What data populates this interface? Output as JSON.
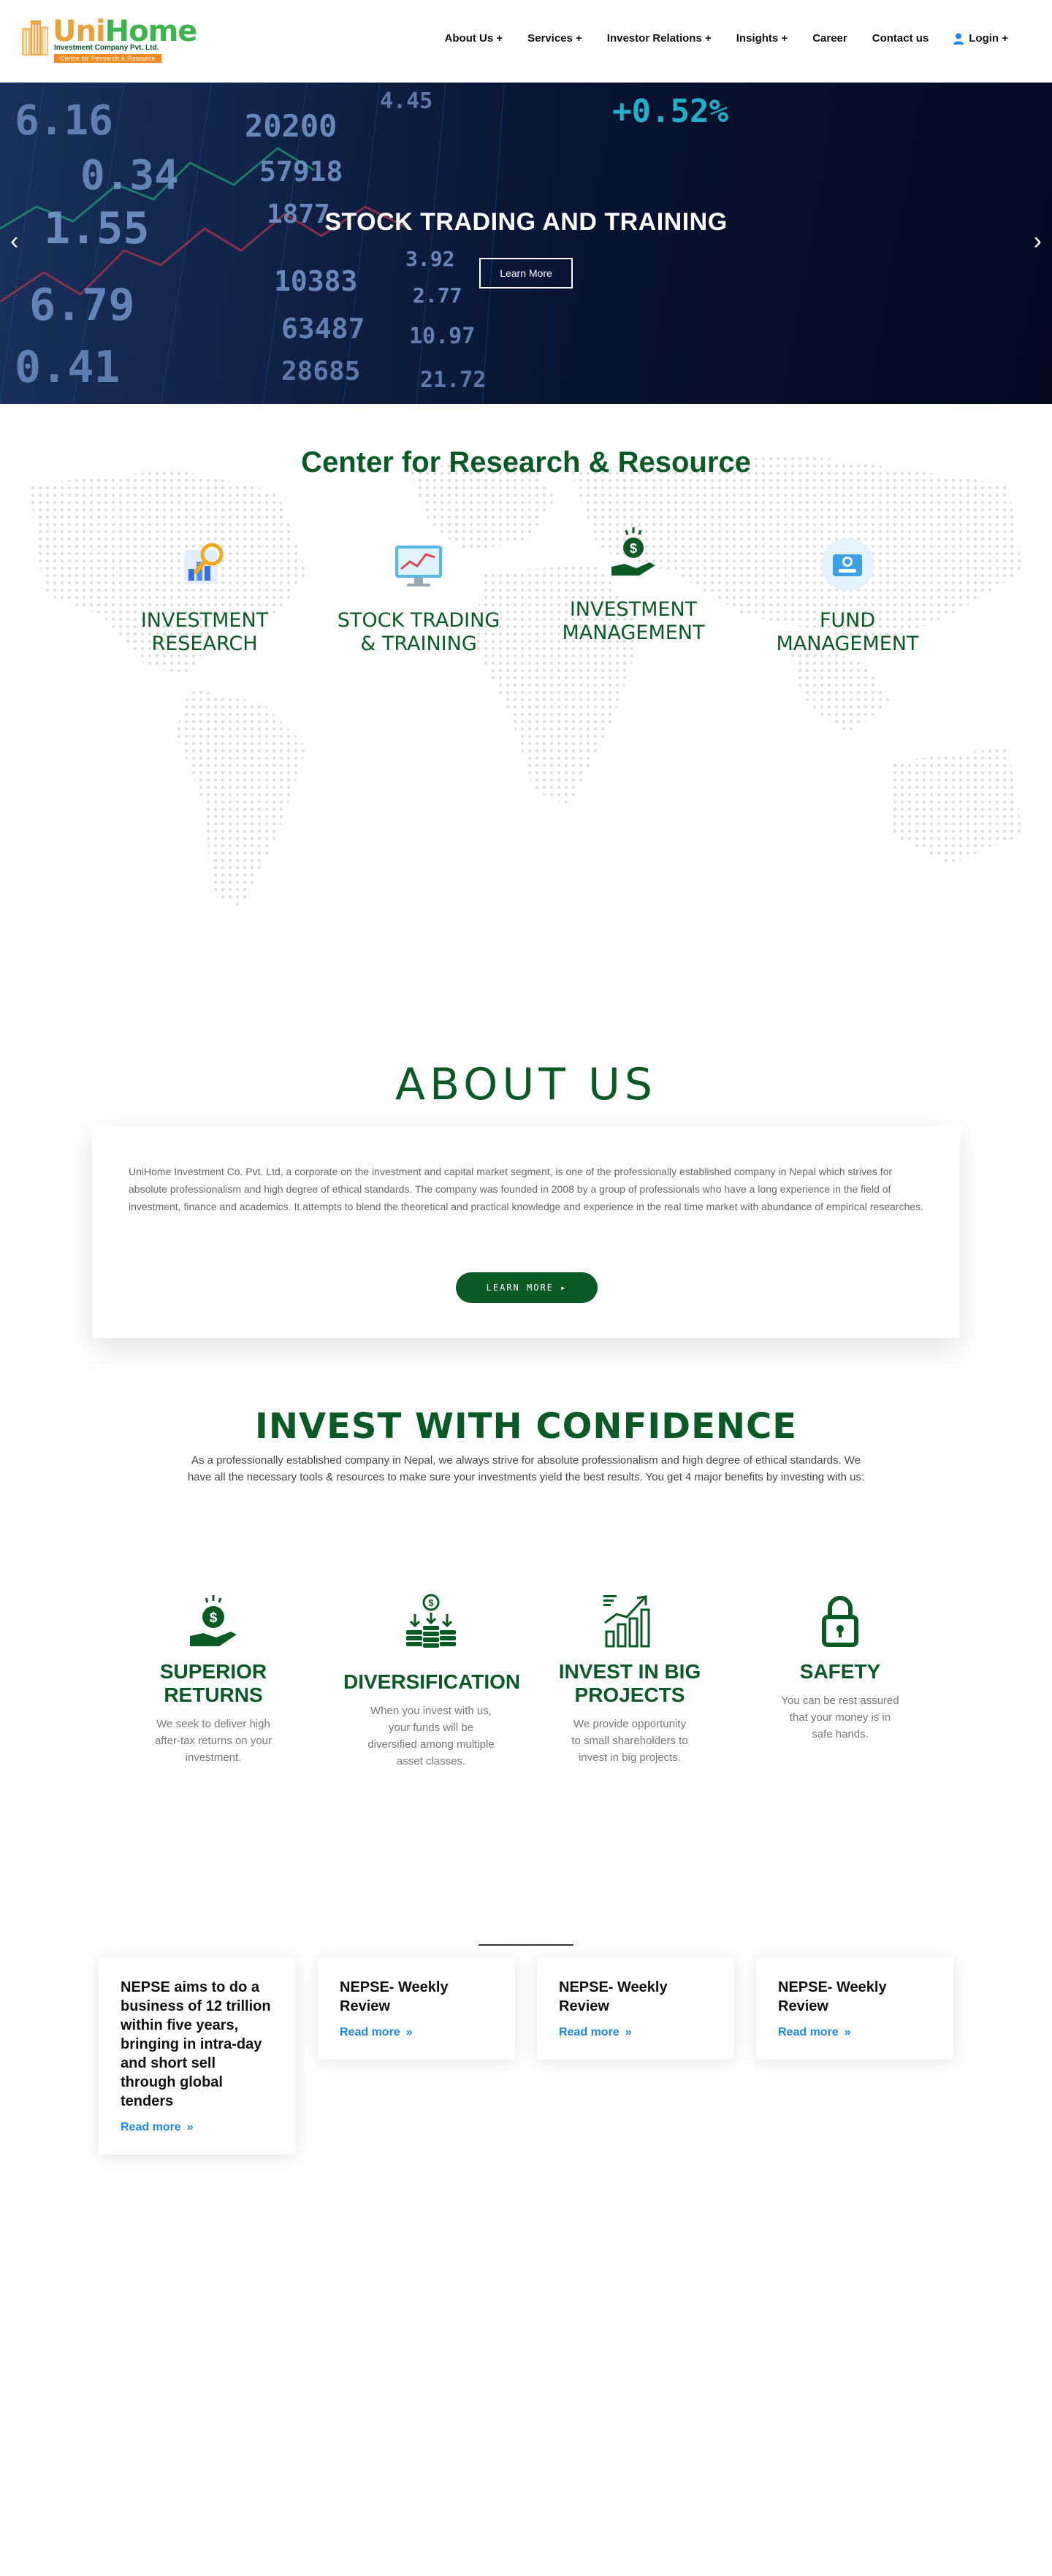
{
  "logo": {
    "uni": "Uni",
    "home": "Home",
    "subtitle": "Investment Company Pvt. Ltd.",
    "tagline": "Centre for Research & Resource"
  },
  "nav": {
    "items": [
      "About Us +",
      "Services +",
      "Investor Relations +",
      "Insights +",
      "Career",
      "Contact us"
    ],
    "login": "Login +"
  },
  "hero": {
    "title": "STOCK TRADING AND TRAINING",
    "button": "Learn More",
    "numbers": [
      "6.16",
      "20200",
      "4.45",
      "0.34",
      "57918",
      "1.55",
      "1877",
      "3.92",
      "10383",
      "6.79",
      "2.77",
      "63487",
      "0.41",
      "10.97",
      "28685",
      "21.72",
      "+0.52%"
    ]
  },
  "research": {
    "title": "Center for Research & Resource",
    "cards": [
      {
        "line1": "INVESTMENT",
        "line2": "RESEARCH",
        "icon": "magnifier-chart-icon"
      },
      {
        "line1": "STOCK TRADING",
        "line2": "& TRAINING",
        "icon": "monitor-chart-icon"
      },
      {
        "line1": "INVESTMENT",
        "line2": "MANAGEMENT",
        "icon": "hand-coin-icon"
      },
      {
        "line1": "FUND",
        "line2": "MANAGEMENT",
        "icon": "camera-wallet-icon"
      }
    ]
  },
  "about": {
    "title": "ABOUT US",
    "text": "UniHome Investment Co. Pvt. Ltd, a corporate on the investment and capital market segment, is one of the professionally established company in Nepal which strives for absolute professionalism and high degree of ethical standards. The company was founded in 2008 by a group of professionals who have a long experience in the field of investment, finance and academics. It attempts to blend the theoretical and practical knowledge and experience in the real time market with abundance of empirical researches.",
    "button": "LEARN MORE"
  },
  "invest": {
    "title": "INVEST WITH CONFIDENCE",
    "intro": "As a  professionally established company in Nepal, we always strive for absolute professionalism and high degree of ethical standards. We have all the necessary tools & resources to make sure your investments yield the best results. You get 4 major benefits by investing with us:",
    "benefits": [
      {
        "title": "SUPERIOR RETURNS",
        "desc": "We seek to deliver high after-tax returns on your investment."
      },
      {
        "title": "DIVERSIFICATION",
        "desc": "When you invest with us, your funds will be diversified among multiple asset classes."
      },
      {
        "title": "INVEST IN BIG PROJECTS",
        "desc": "We provide opportunity to small shareholders to invest in big projects."
      },
      {
        "title": "SAFETY",
        "desc": "You can be rest assured that your money is in safe hands."
      }
    ]
  },
  "news": {
    "read_more": "Read more",
    "items": [
      {
        "title": "NEPSE aims to do a business of 12 trillion within five years, bringing in intra-day and short sell through global tenders"
      },
      {
        "title": "NEPSE- Weekly Review"
      },
      {
        "title": "NEPSE- Weekly Review"
      },
      {
        "title": "NEPSE- Weekly Review"
      }
    ]
  },
  "colors": {
    "brand_green": "#0a5a25",
    "link_blue": "#1e88e5",
    "logo_orange": "#f28b1f"
  }
}
